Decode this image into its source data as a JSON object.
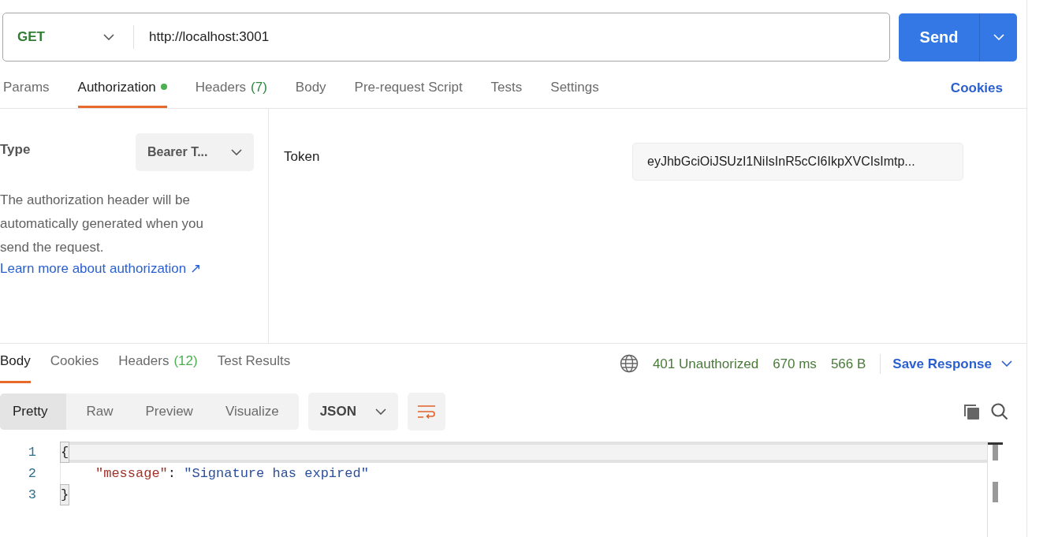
{
  "request": {
    "method": "GET",
    "url": "http://localhost:3001",
    "send_label": "Send"
  },
  "request_tabs": [
    {
      "label": "Params",
      "has_dot": false,
      "selected": false
    },
    {
      "label": "Authorization",
      "has_dot": true,
      "selected": true
    },
    {
      "label": "Headers",
      "count": "(7)",
      "has_dot": false,
      "selected": false
    },
    {
      "label": "Body",
      "has_dot": false,
      "selected": false
    },
    {
      "label": "Pre-request Script",
      "has_dot": false,
      "selected": false
    },
    {
      "label": "Tests",
      "has_dot": false,
      "selected": false
    },
    {
      "label": "Settings",
      "has_dot": false,
      "selected": false
    }
  ],
  "cookies_link": "Cookies",
  "auth": {
    "type_label": "Type",
    "type_value": "Bearer T...",
    "description": "The authorization header will be automatically generated when you send the request.",
    "learn_more": "Learn more about authorization ↗",
    "token_label": "Token",
    "token_value": "eyJhbGciOiJSUzI1NiIsInR5cCI6IkpXVCIsImtp..."
  },
  "response_tabs": [
    {
      "label": "Body",
      "selected": true
    },
    {
      "label": "Cookies",
      "selected": false
    },
    {
      "label": "Headers",
      "count": "(12)",
      "selected": false
    },
    {
      "label": "Test Results",
      "selected": false
    }
  ],
  "response_meta": {
    "status": "401 Unauthorized",
    "time": "670 ms",
    "size": "566 B",
    "save_label": "Save Response"
  },
  "view_modes": [
    {
      "label": "Pretty",
      "selected": true
    },
    {
      "label": "Raw",
      "selected": false
    },
    {
      "label": "Preview",
      "selected": false
    },
    {
      "label": "Visualize",
      "selected": false
    }
  ],
  "format": "JSON",
  "code_lines": [
    {
      "number": "1",
      "current": true,
      "tokens": [
        {
          "kind": "bracket",
          "text": "{"
        }
      ]
    },
    {
      "number": "2",
      "current": false,
      "tokens": [
        {
          "kind": "key",
          "text": "\"message\""
        },
        {
          "kind": "punct",
          "text": ": "
        },
        {
          "kind": "string",
          "text": "\"Signature has expired\""
        }
      ]
    },
    {
      "number": "3",
      "current": false,
      "tokens": [
        {
          "kind": "bracket",
          "text": "}"
        }
      ]
    }
  ]
}
